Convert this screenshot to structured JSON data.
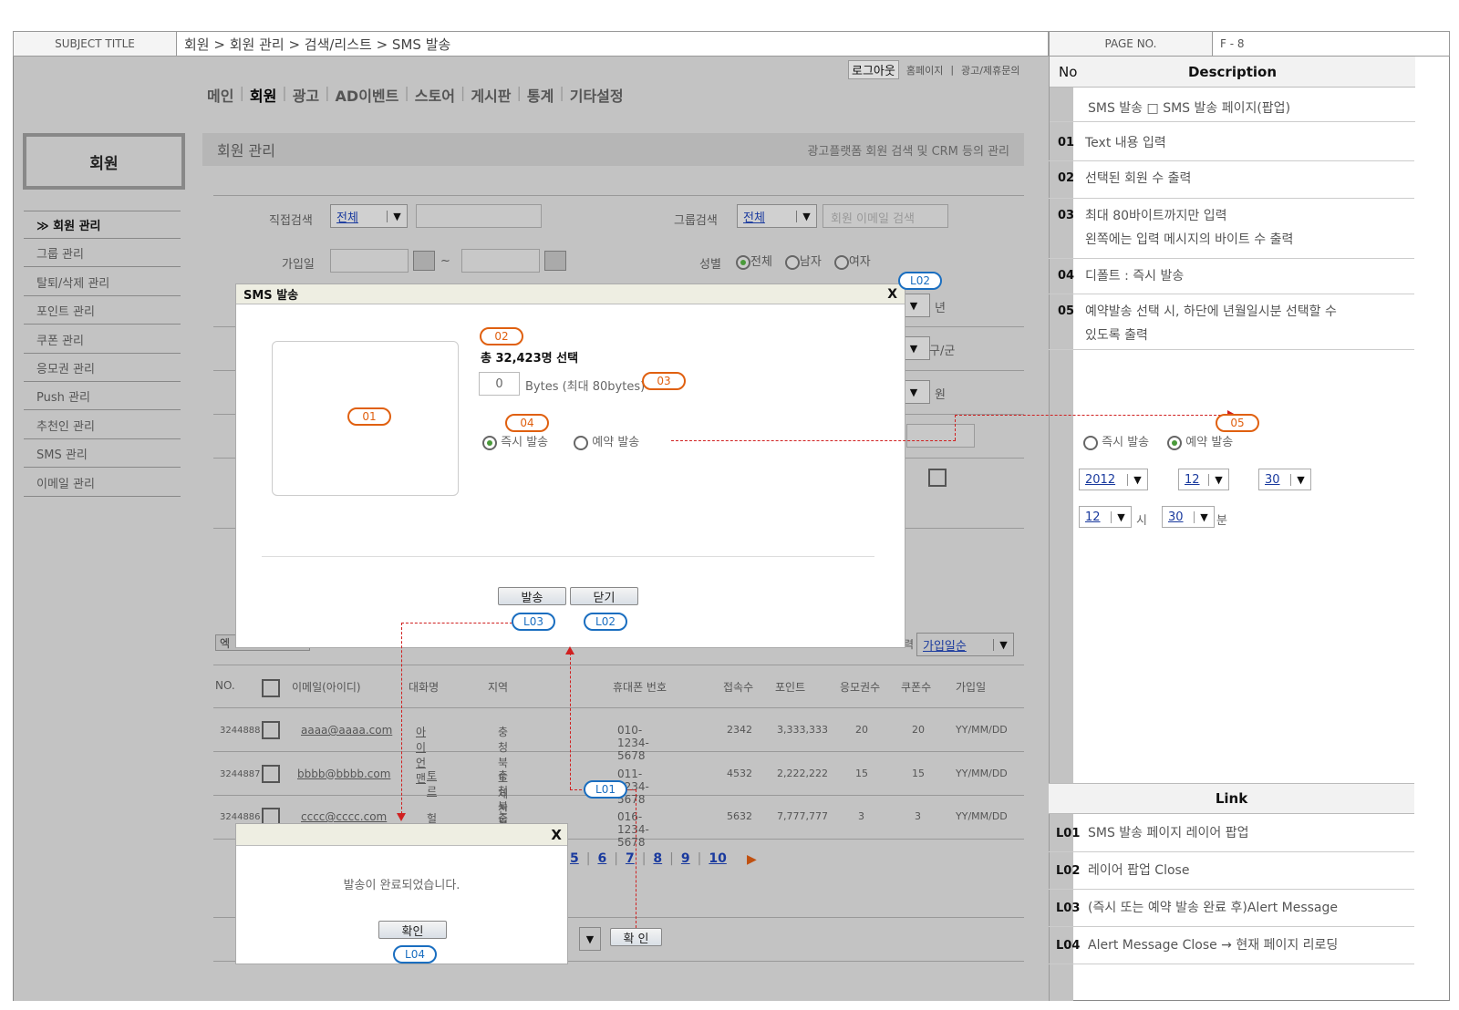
{
  "header": {
    "subject_label": "SUBJECT  TITLE",
    "breadcrumb": "회원 > 회원 관리 > 검색/리스트 > SMS 발송",
    "page_no_label": "PAGE  NO.",
    "page_no": "F - 8"
  },
  "topnav": {
    "logout": "로그아웃",
    "homepage": "홈페이지",
    "sep": "|",
    "contact": "광고/제휴문의",
    "menu": [
      "메인",
      "회원",
      "광고",
      "AD이벤트",
      "스토어",
      "게시판",
      "통계",
      "기타설정"
    ]
  },
  "sidebar": {
    "title": "회원",
    "items": [
      "≫ 회원 관리",
      "그룹 관리",
      "탈퇴/삭제 관리",
      "포인트 관리",
      "쿠폰 관리",
      "응모권 관리",
      "Push 관리",
      "추천인 관리",
      "SMS 관리",
      "이메일 관리"
    ]
  },
  "section": {
    "title": "회원 관리",
    "subtitle": "광고플랫폼 회원 검색 및 CRM 등의 관리"
  },
  "search": {
    "direct_label": "직접검색",
    "direct_value": "전체",
    "group_label": "그룹검색",
    "group_value": "전체",
    "email_placeholder": "회원 이메일 검색",
    "join_label": "가입일",
    "tilde": "~",
    "gender_label": "성별",
    "gender_all": "전체",
    "gender_male": "남자",
    "gender_female": "여자",
    "year_suffix": "년",
    "district_suffix": "구/군",
    "won_suffix": "원",
    "sort_value": "가입일순",
    "sort_prefix": "력",
    "excel_prefix": "엑"
  },
  "table": {
    "headers": [
      "NO.",
      "이메일(아이디)",
      "대화명",
      "지역",
      "휴대폰 번호",
      "접속수",
      "포인트",
      "응모권수",
      "쿠폰수",
      "가입일"
    ],
    "rows": [
      {
        "no": "3244888",
        "email": "aaaa@aaaa.com",
        "nick": "아이언맨",
        "region": "충청북도 제천시",
        "phone": "010-1234-5678",
        "visits": "2342",
        "points": "3,333,333",
        "tickets": "20",
        "coupons": "20",
        "joined": "YY/MM/DD"
      },
      {
        "no": "3244887",
        "email": "bbbb@bbbb.com",
        "nick": "토르",
        "region": "충청북도 제천시",
        "phone": "011-1234-5678",
        "visits": "4532",
        "points": "2,222,222",
        "tickets": "15",
        "coupons": "15",
        "joined": "YY/MM/DD"
      },
      {
        "no": "3244886",
        "email": "cccc@cccc.com",
        "nick": "헐크",
        "region": "충청북도 제천시",
        "phone": "016-1234-5678",
        "visits": "5632",
        "points": "7,777,777",
        "tickets": "3",
        "coupons": "3",
        "joined": "YY/MM/DD"
      }
    ]
  },
  "pagination": [
    "5",
    "6",
    "7",
    "8",
    "9",
    "10"
  ],
  "pagination_next": "▶",
  "confirm_button": "확 인",
  "sms_modal": {
    "title": "SMS 발송",
    "close": "X",
    "selected_text": "총 32,423명 선택",
    "bytes_value": "0",
    "bytes_label": "Bytes (최대 80bytes)",
    "radio_now": "즉시 발송",
    "radio_reserve": "예약 발송",
    "send_button": "발송",
    "close_button": "닫기"
  },
  "alert_modal": {
    "close": "X",
    "message": "발송이 완료되었습니다.",
    "ok_button": "확인"
  },
  "badges": {
    "b01": "01",
    "b02": "02",
    "b03": "03",
    "b04": "04",
    "b05": "05",
    "l01": "L01",
    "l02": "L02",
    "l03": "L03",
    "l04": "L04"
  },
  "right_panel": {
    "col_no": "No",
    "col_desc": "Description",
    "intro": "SMS 발송 □ SMS 발송 페이지(팝업)",
    "descriptions": [
      {
        "no": "01",
        "text": "Text 내용 입력"
      },
      {
        "no": "02",
        "text": "선택된 회원 수 출력"
      },
      {
        "no": "03",
        "text": "최대 80바이트까지만 입력",
        "text2": "왼쪽에는 입력 메시지의 바이트 수 출력"
      },
      {
        "no": "04",
        "text": "디폴트 : 즉시 발송"
      },
      {
        "no": "05",
        "text": "예약발송 선택 시, 하단에 년월일시분 선택할 수",
        "text2": "있도록 출력"
      }
    ],
    "preview": {
      "radio_now": "즉시 발송",
      "radio_reserve": "예약 발송",
      "year": "2012",
      "month": "12",
      "day": "30",
      "hour": "12",
      "hour_suffix": "시",
      "minute": "30",
      "minute_suffix": "분"
    },
    "link_title": "Link",
    "links": [
      {
        "no": "L01",
        "text": "SMS 발송 페이지 레이어 팝업"
      },
      {
        "no": "L02",
        "text": "레이어 팝업 Close"
      },
      {
        "no": "L03",
        "text": "(즉시 또는 예약 발송 완료 후)Alert Message"
      },
      {
        "no": "L04",
        "text": "Alert Message Close → 현재 페이지 리로딩"
      }
    ]
  }
}
